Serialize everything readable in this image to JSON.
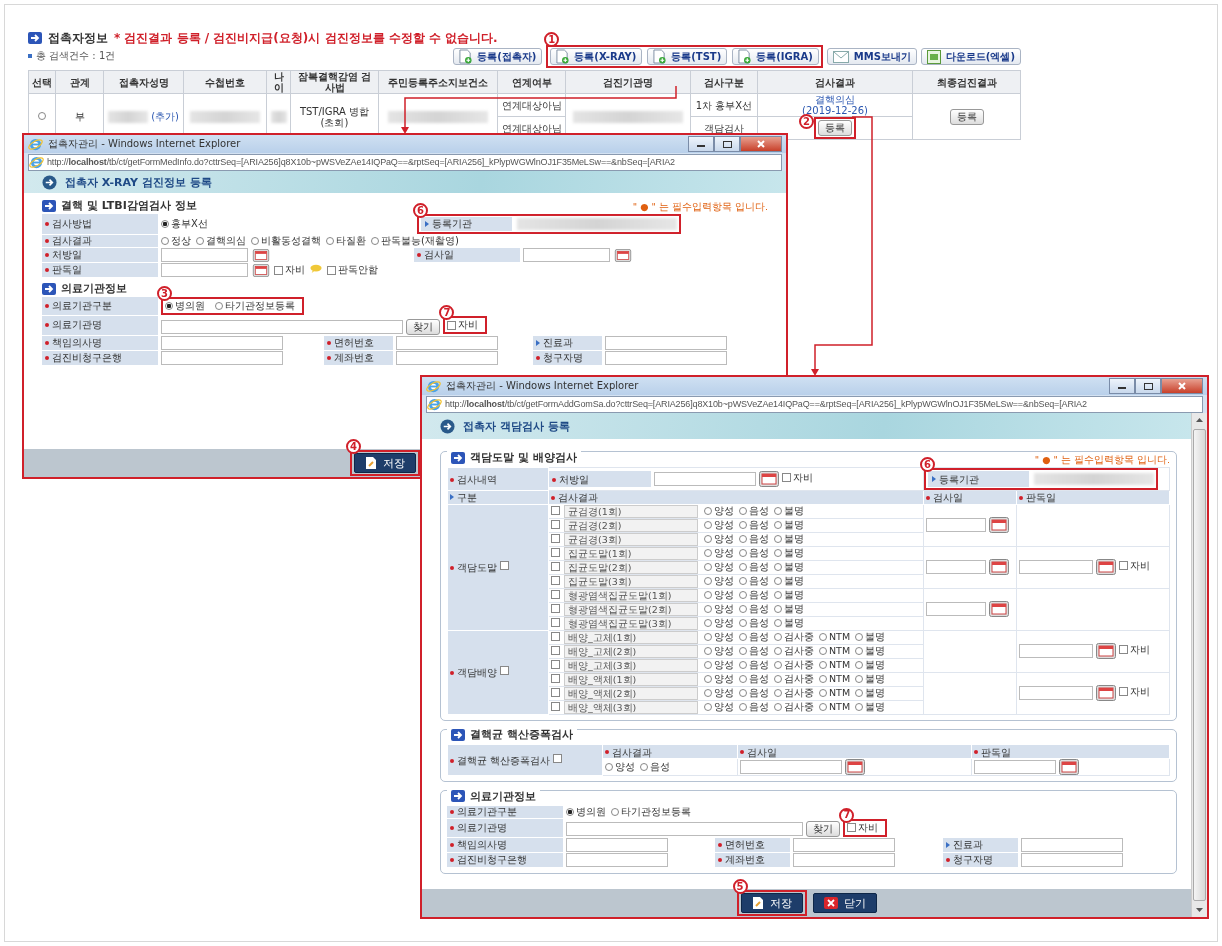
{
  "header": {
    "title": "접촉자정보",
    "warning": "* 검진결과 등록 / 검진비지급(요청)시 검진정보를 수정할 수 없습니다."
  },
  "count": "총 검색건수 : 1건",
  "toolbar": [
    {
      "kind": "add_button",
      "label": "등록(접촉자)"
    },
    {
      "kind": "callout_group",
      "callout": "1",
      "buttons": [
        {
          "label": "등록(X-RAY)"
        },
        {
          "label": "등록(TST)"
        },
        {
          "label": "등록(IGRA)"
        }
      ]
    },
    {
      "kind": "mail_button",
      "label": "MMS보내기"
    },
    {
      "kind": "excel_button",
      "label": "다운로드(엑셀)"
    }
  ],
  "table": {
    "columns": [
      "선택",
      "관계",
      "접촉자성명",
      "수첩번호",
      "나이",
      "잠복결핵감염 검사법",
      "주민등록주소지보건소",
      "연계여부",
      "검진기관명",
      "검사구분",
      "검사결과",
      "최종검진결과"
    ],
    "rows": [
      {
        "selected": false,
        "relation": "부",
        "name_link": "(추가)",
        "method": "TST/IGRA 병합(초회)",
        "final_button": "등록",
        "subrows": [
          {
            "link_status": "연계대상아님",
            "test_type": "1차 흉부X선",
            "result": {
              "kind": "link",
              "text": "결핵의심",
              "date": "(2019-12-26)"
            }
          },
          {
            "link_status": "연계대상아님",
            "test_type": "객담검사",
            "result": {
              "kind": "button",
              "text": "등록",
              "callout": "2"
            }
          }
        ]
      }
    ]
  },
  "xray_window": {
    "title": "접촉자관리 - Windows Internet Explorer",
    "url": "http://**localhost**/tb/ct/getFormMedInfo.do?cttrSeq=[ARIA256]q8X10b~pWSVeZAe14IQPaQ==&rptSeq=[ARIA256]_kPlypWGWlnOJ1F35MeLSw==&nbSeq=[ARIA2",
    "heading": "접촉자 X-RAY 검진정보 등록",
    "required_note": "\" ● \" 는 필수입력항목 입니다.",
    "exam": {
      "title": "결핵 및 LTBI감염검사 정보",
      "method": {
        "label": "검사방법",
        "options": [
          {
            "label": "흉부X선",
            "selected": true
          }
        ]
      },
      "agency": {
        "label": "등록기관",
        "callout": "6"
      },
      "result": {
        "label": "검사결과",
        "options": [
          {
            "label": "정상",
            "selected": false
          },
          {
            "label": "결핵의심",
            "selected": false
          },
          {
            "label": "비활동성결핵",
            "selected": false
          },
          {
            "label": "타질환",
            "selected": false
          },
          {
            "label": "판독불능(재촬영)",
            "selected": false
          }
        ]
      },
      "prescribed": {
        "label": "처방일"
      },
      "exam_date": {
        "label": "검사일"
      },
      "read_date": {
        "label": "판독일",
        "self_pay": {
          "label": "자비",
          "checked": false
        },
        "no_read": {
          "label": "판독안함",
          "checked": false
        }
      }
    },
    "institution": {
      "title": "의료기관정보",
      "type": {
        "label": "의료기관구분",
        "callout": "3",
        "options": [
          {
            "label": "병의원",
            "selected": true
          },
          {
            "label": "타기관정보등록",
            "selected": false
          }
        ]
      },
      "name": {
        "label": "의료기관명",
        "search": "찾기",
        "self_pay": {
          "label": "자비",
          "checked": false,
          "callout": "7"
        }
      },
      "fields": [
        {
          "label": "책임의사명",
          "required": true
        },
        {
          "label": "면허번호",
          "required": true
        },
        {
          "label": "진료과",
          "required": false
        },
        {
          "label": "검진비청구은행",
          "required": true
        },
        {
          "label": "계좌번호",
          "required": true
        },
        {
          "label": "청구자명",
          "required": true
        }
      ]
    },
    "buttons": [
      {
        "label": "저장",
        "kind": "save",
        "callout": "4"
      }
    ]
  },
  "sputum_window": {
    "title": "접촉자관리 - Windows Internet Explorer",
    "url": "http://**localhost**/tb/ct/getFormAddGomSa.do?cttrSeq=[ARIA256]q8X10b~pWSVeZAe14IQPaQ==&rptSeq=[ARIA256]_kPlypWGWlnOJ1F35MeLSw==&nbSeq=[ARIA2",
    "heading": "접촉자 객담검사 등록",
    "required_note": "\" ● \" 는 필수입력항목 입니다.",
    "smear_culture": {
      "title": "객담도말 및 배양검사",
      "history_label": "검사내역",
      "prescribed": {
        "label": "처방일",
        "self_pay": {
          "label": "자비",
          "checked": false
        }
      },
      "agency": {
        "label": "등록기관",
        "callout": "6"
      },
      "columns": [
        {
          "label": "구분",
          "required": false
        },
        {
          "label": "검사결과",
          "required": true
        },
        {
          "label": "검사일",
          "required": true
        },
        {
          "label": "판독일",
          "required": true
        }
      ],
      "groups": [
        {
          "label": "객담도말",
          "checked": false,
          "blocks": [
            {
              "exam_date": true,
              "tests": [
                {
                  "label": "균검경(1회)",
                  "checked": false,
                  "options": [
                    {
                      "label": "양성",
                      "selected": false
                    },
                    {
                      "label": "음성",
                      "selected": false
                    },
                    {
                      "label": "불명",
                      "selected": false
                    }
                  ]
                },
                {
                  "label": "균검경(2회)",
                  "checked": false,
                  "options": [
                    {
                      "label": "양성",
                      "selected": false
                    },
                    {
                      "label": "음성",
                      "selected": false
                    },
                    {
                      "label": "불명",
                      "selected": false
                    }
                  ]
                },
                {
                  "label": "균검경(3회)",
                  "checked": false,
                  "options": [
                    {
                      "label": "양성",
                      "selected": false
                    },
                    {
                      "label": "음성",
                      "selected": false
                    },
                    {
                      "label": "불명",
                      "selected": false
                    }
                  ]
                }
              ]
            },
            {
              "exam_date": true,
              "read_self_pay": {
                "label": "자비",
                "checked": false
              },
              "tests": [
                {
                  "label": "집균도말(1회)",
                  "checked": false,
                  "options": [
                    {
                      "label": "양성",
                      "selected": false
                    },
                    {
                      "label": "음성",
                      "selected": false
                    },
                    {
                      "label": "불명",
                      "selected": false
                    }
                  ]
                },
                {
                  "label": "집균도말(2회)",
                  "checked": false,
                  "options": [
                    {
                      "label": "양성",
                      "selected": false
                    },
                    {
                      "label": "음성",
                      "selected": false
                    },
                    {
                      "label": "불명",
                      "selected": false
                    }
                  ]
                },
                {
                  "label": "집균도말(3회)",
                  "checked": false,
                  "options": [
                    {
                      "label": "양성",
                      "selected": false
                    },
                    {
                      "label": "음성",
                      "selected": false
                    },
                    {
                      "label": "불명",
                      "selected": false
                    }
                  ]
                }
              ]
            },
            {
              "exam_date": true,
              "tests": [
                {
                  "label": "형광염색집균도말(1회)",
                  "checked": false,
                  "options": [
                    {
                      "label": "양성",
                      "selected": false
                    },
                    {
                      "label": "음성",
                      "selected": false
                    },
                    {
                      "label": "불명",
                      "selected": false
                    }
                  ]
                },
                {
                  "label": "형광염색집균도말(2회)",
                  "checked": false,
                  "options": [
                    {
                      "label": "양성",
                      "selected": false
                    },
                    {
                      "label": "음성",
                      "selected": false
                    },
                    {
                      "label": "불명",
                      "selected": false
                    }
                  ]
                },
                {
                  "label": "형광염색집균도말(3회)",
                  "checked": false,
                  "options": [
                    {
                      "label": "양성",
                      "selected": false
                    },
                    {
                      "label": "음성",
                      "selected": false
                    },
                    {
                      "label": "불명",
                      "selected": false
                    }
                  ]
                }
              ]
            }
          ]
        },
        {
          "label": "객담배양",
          "checked": false,
          "blocks": [
            {
              "exam_date": false,
              "read_self_pay": {
                "label": "자비",
                "checked": false
              },
              "tests": [
                {
                  "label": "배양_고체(1회)",
                  "checked": false,
                  "options": [
                    {
                      "label": "양성",
                      "selected": false
                    },
                    {
                      "label": "음성",
                      "selected": false
                    },
                    {
                      "label": "검사중",
                      "selected": false
                    },
                    {
                      "label": "NTM",
                      "selected": false
                    },
                    {
                      "label": "불명",
                      "selected": false
                    }
                  ]
                },
                {
                  "label": "배양_고체(2회)",
                  "checked": false,
                  "options": [
                    {
                      "label": "양성",
                      "selected": false
                    },
                    {
                      "label": "음성",
                      "selected": false
                    },
                    {
                      "label": "검사중",
                      "selected": false
                    },
                    {
                      "label": "NTM",
                      "selected": false
                    },
                    {
                      "label": "불명",
                      "selected": false
                    }
                  ]
                },
                {
                  "label": "배양_고체(3회)",
                  "checked": false,
                  "options": [
                    {
                      "label": "양성",
                      "selected": false
                    },
                    {
                      "label": "음성",
                      "selected": false
                    },
                    {
                      "label": "검사중",
                      "selected": false
                    },
                    {
                      "label": "NTM",
                      "selected": false
                    },
                    {
                      "label": "불명",
                      "selected": false
                    }
                  ]
                }
              ]
            },
            {
              "exam_date": false,
              "read_self_pay": {
                "label": "자비",
                "checked": false
              },
              "tests": [
                {
                  "label": "배양_액체(1회)",
                  "checked": false,
                  "options": [
                    {
                      "label": "양성",
                      "selected": false
                    },
                    {
                      "label": "음성",
                      "selected": false
                    },
                    {
                      "label": "검사중",
                      "selected": false
                    },
                    {
                      "label": "NTM",
                      "selected": false
                    },
                    {
                      "label": "불명",
                      "selected": false
                    }
                  ]
                },
                {
                  "label": "배양_액체(2회)",
                  "checked": false,
                  "options": [
                    {
                      "label": "양성",
                      "selected": false
                    },
                    {
                      "label": "음성",
                      "selected": false
                    },
                    {
                      "label": "검사중",
                      "selected": false
                    },
                    {
                      "label": "NTM",
                      "selected": false
                    },
                    {
                      "label": "불명",
                      "selected": false
                    }
                  ]
                },
                {
                  "label": "배양_액체(3회)",
                  "checked": false,
                  "options": [
                    {
                      "label": "양성",
                      "selected": false
                    },
                    {
                      "label": "음성",
                      "selected": false
                    },
                    {
                      "label": "검사중",
                      "selected": false
                    },
                    {
                      "label": "NTM",
                      "selected": false
                    },
                    {
                      "label": "불명",
                      "selected": false
                    }
                  ]
                }
              ]
            }
          ]
        }
      ]
    },
    "naat": {
      "title": "결핵균 핵산증폭검사",
      "label": "결핵균 핵산증폭검사",
      "checked": false,
      "columns": [
        "검사결과",
        "검사일",
        "판독일"
      ],
      "options": [
        {
          "label": "양성",
          "selected": false
        },
        {
          "label": "음성",
          "selected": false
        }
      ]
    },
    "institution": {
      "title": "의료기관정보",
      "type": {
        "label": "의료기관구분",
        "options": [
          {
            "label": "병의원",
            "selected": true
          },
          {
            "label": "타기관정보등록",
            "selected": false
          }
        ]
      },
      "name": {
        "label": "의료기관명",
        "search": "찾기",
        "self_pay": {
          "label": "자비",
          "checked": false,
          "callout": "7"
        }
      },
      "fields": [
        {
          "label": "책임의사명",
          "required": true
        },
        {
          "label": "면허번호",
          "required": true
        },
        {
          "label": "진료과",
          "required": false
        },
        {
          "label": "검진비청구은행",
          "required": true
        },
        {
          "label": "계좌번호",
          "required": true
        },
        {
          "label": "청구자명",
          "required": true
        }
      ]
    },
    "buttons": [
      {
        "label": "저장",
        "kind": "save",
        "callout": "5"
      },
      {
        "label": "닫기",
        "kind": "close"
      }
    ]
  }
}
